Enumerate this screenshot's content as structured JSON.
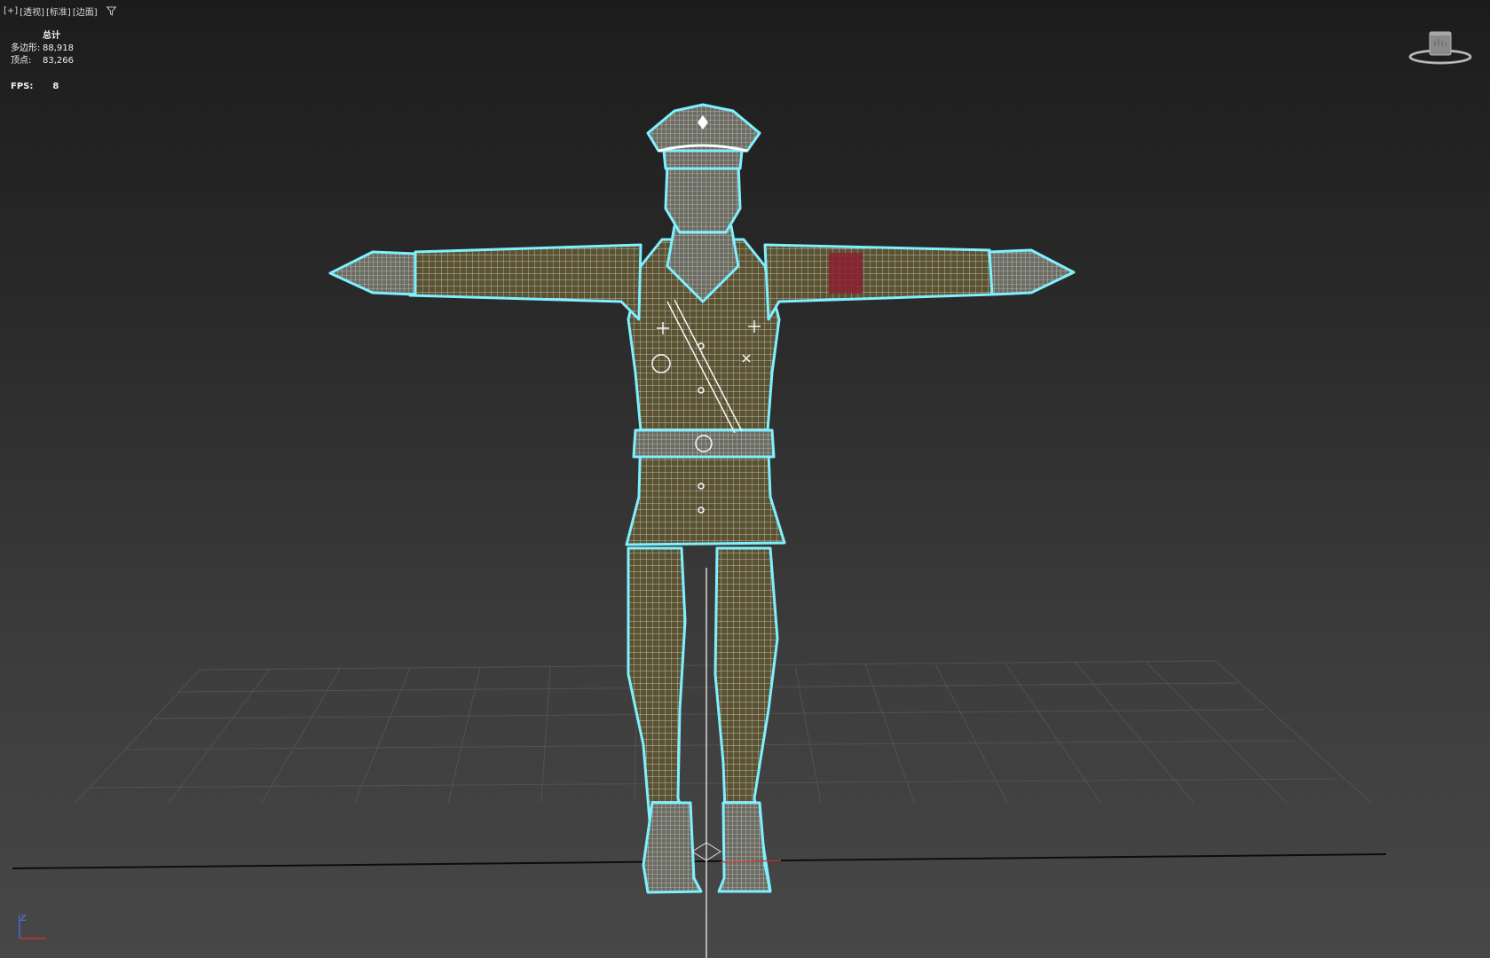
{
  "viewport": {
    "labels": [
      "[+]",
      "[透视]",
      "[标准]",
      "[边面]"
    ]
  },
  "stats": {
    "header": "总计",
    "polygons_label": "多边形:",
    "polygons_value": "88,918",
    "vertices_label": "顶点:",
    "vertices_value": "83,266"
  },
  "fps": {
    "label": "FPS:",
    "value": "8"
  },
  "axis": {
    "z_label": "Z"
  },
  "colors": {
    "wireframe_outline": "#7ff0ff",
    "mesh_fill": "#5b5232",
    "wire": "#e8f4f4",
    "grid": "#5a5a5a",
    "horizon": "#0d0d0d"
  }
}
